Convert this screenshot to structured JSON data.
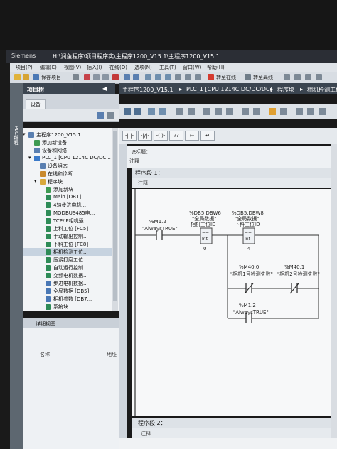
{
  "window": {
    "app": "Siemens",
    "path": "H:\\润鱼程序\\项目程序实\\主程序1200_V15.1\\主程序1200_V15.1"
  },
  "menu": [
    "项目(P)",
    "编辑(E)",
    "视图(V)",
    "插入(I)",
    "在线(O)",
    "选项(N)",
    "工具(T)",
    "窗口(W)",
    "帮助(H)"
  ],
  "toolbar": {
    "save_label": "保存项目",
    "go_online": "转至在线",
    "go_offline": "转至离线"
  },
  "project_tree": {
    "title": "项目树",
    "tab": "设备",
    "vertical_tab": "PLC编程",
    "items": [
      {
        "label": "主程序1200_V15.1",
        "level": 0
      },
      {
        "label": "添加新设备",
        "level": 1
      },
      {
        "label": "设备和网络",
        "level": 1
      },
      {
        "label": "PLC_1 [CPU 1214C DC/DC...",
        "level": 1
      },
      {
        "label": "设备组态",
        "level": 2
      },
      {
        "label": "在线和诊断",
        "level": 2
      },
      {
        "label": "程序块",
        "level": 2
      },
      {
        "label": "添加新块",
        "level": 3
      },
      {
        "label": "Main [OB1]",
        "level": 3
      },
      {
        "label": "4轴步进电机...",
        "level": 3
      },
      {
        "label": "MODBUS485电...",
        "level": 3
      },
      {
        "label": "TCP/IP相机通...",
        "level": 3
      },
      {
        "label": "上料工位 [FC5]",
        "level": 3
      },
      {
        "label": "手动输出控制...",
        "level": 3
      },
      {
        "label": "下料工位 [FC8]",
        "level": 3
      },
      {
        "label": "相机检测工位...",
        "level": 3
      },
      {
        "label": "压紧打磨工位...",
        "level": 3
      },
      {
        "label": "自动运行控制...",
        "level": 3
      },
      {
        "label": "变频电机数据...",
        "level": 3
      },
      {
        "label": "步进电机数据...",
        "level": 3
      },
      {
        "label": "全局数据 [DB5]",
        "level": 3
      },
      {
        "label": "相机参数 [DB7...",
        "level": 3
      },
      {
        "label": "系统块",
        "level": 3
      }
    ]
  },
  "detail_view": {
    "title": "详细视图",
    "col_name": "名称",
    "col_address": "地址"
  },
  "editor": {
    "breadcrumb": [
      "主程序1200_V15.1",
      "PLC_1 [CPU 1214C DC/DC/DC]",
      "程序块",
      "相机检测工位"
    ],
    "block_title": "块标题：",
    "block_comment": "注释",
    "networks": [
      {
        "title": "程序段 1：",
        "comment": "注释"
      },
      {
        "title": "程序段 2：",
        "comment": "注释"
      }
    ]
  },
  "ladder": {
    "contact1": {
      "addr": "%M1.2",
      "name": "\"AlwaysTRUE\""
    },
    "cmp1": {
      "addr": "%DB5.DBW6",
      "name1": "\"全局数据\".",
      "name2": "相机工位ID",
      "op": "==",
      "type": "Int",
      "value": "0"
    },
    "cmp2": {
      "addr": "%DB5.DBW8",
      "name1": "\"全局数据\".",
      "name2": "下料工位ID",
      "op": "==",
      "type": "Int",
      "value": "4"
    },
    "contact2": {
      "addr": "%M40.0",
      "name": "\"相机1号检测失败\""
    },
    "contact3": {
      "addr": "%M40.1",
      "name": "\"相机2号检测失败\""
    },
    "contact4": {
      "addr": "%M1.2",
      "name": "\"AlwaysTRUE\""
    }
  }
}
